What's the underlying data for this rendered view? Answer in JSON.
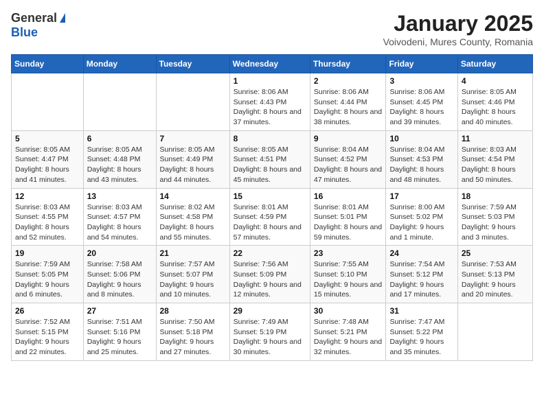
{
  "header": {
    "logo_general": "General",
    "logo_blue": "Blue",
    "month": "January 2025",
    "location": "Voivodeni, Mures County, Romania"
  },
  "weekdays": [
    "Sunday",
    "Monday",
    "Tuesday",
    "Wednesday",
    "Thursday",
    "Friday",
    "Saturday"
  ],
  "weeks": [
    [
      {
        "day": "",
        "info": ""
      },
      {
        "day": "",
        "info": ""
      },
      {
        "day": "",
        "info": ""
      },
      {
        "day": "1",
        "info": "Sunrise: 8:06 AM\nSunset: 4:43 PM\nDaylight: 8 hours and 37 minutes."
      },
      {
        "day": "2",
        "info": "Sunrise: 8:06 AM\nSunset: 4:44 PM\nDaylight: 8 hours and 38 minutes."
      },
      {
        "day": "3",
        "info": "Sunrise: 8:06 AM\nSunset: 4:45 PM\nDaylight: 8 hours and 39 minutes."
      },
      {
        "day": "4",
        "info": "Sunrise: 8:05 AM\nSunset: 4:46 PM\nDaylight: 8 hours and 40 minutes."
      }
    ],
    [
      {
        "day": "5",
        "info": "Sunrise: 8:05 AM\nSunset: 4:47 PM\nDaylight: 8 hours and 41 minutes."
      },
      {
        "day": "6",
        "info": "Sunrise: 8:05 AM\nSunset: 4:48 PM\nDaylight: 8 hours and 43 minutes."
      },
      {
        "day": "7",
        "info": "Sunrise: 8:05 AM\nSunset: 4:49 PM\nDaylight: 8 hours and 44 minutes."
      },
      {
        "day": "8",
        "info": "Sunrise: 8:05 AM\nSunset: 4:51 PM\nDaylight: 8 hours and 45 minutes."
      },
      {
        "day": "9",
        "info": "Sunrise: 8:04 AM\nSunset: 4:52 PM\nDaylight: 8 hours and 47 minutes."
      },
      {
        "day": "10",
        "info": "Sunrise: 8:04 AM\nSunset: 4:53 PM\nDaylight: 8 hours and 48 minutes."
      },
      {
        "day": "11",
        "info": "Sunrise: 8:03 AM\nSunset: 4:54 PM\nDaylight: 8 hours and 50 minutes."
      }
    ],
    [
      {
        "day": "12",
        "info": "Sunrise: 8:03 AM\nSunset: 4:55 PM\nDaylight: 8 hours and 52 minutes."
      },
      {
        "day": "13",
        "info": "Sunrise: 8:03 AM\nSunset: 4:57 PM\nDaylight: 8 hours and 54 minutes."
      },
      {
        "day": "14",
        "info": "Sunrise: 8:02 AM\nSunset: 4:58 PM\nDaylight: 8 hours and 55 minutes."
      },
      {
        "day": "15",
        "info": "Sunrise: 8:01 AM\nSunset: 4:59 PM\nDaylight: 8 hours and 57 minutes."
      },
      {
        "day": "16",
        "info": "Sunrise: 8:01 AM\nSunset: 5:01 PM\nDaylight: 8 hours and 59 minutes."
      },
      {
        "day": "17",
        "info": "Sunrise: 8:00 AM\nSunset: 5:02 PM\nDaylight: 9 hours and 1 minute."
      },
      {
        "day": "18",
        "info": "Sunrise: 7:59 AM\nSunset: 5:03 PM\nDaylight: 9 hours and 3 minutes."
      }
    ],
    [
      {
        "day": "19",
        "info": "Sunrise: 7:59 AM\nSunset: 5:05 PM\nDaylight: 9 hours and 6 minutes."
      },
      {
        "day": "20",
        "info": "Sunrise: 7:58 AM\nSunset: 5:06 PM\nDaylight: 9 hours and 8 minutes."
      },
      {
        "day": "21",
        "info": "Sunrise: 7:57 AM\nSunset: 5:07 PM\nDaylight: 9 hours and 10 minutes."
      },
      {
        "day": "22",
        "info": "Sunrise: 7:56 AM\nSunset: 5:09 PM\nDaylight: 9 hours and 12 minutes."
      },
      {
        "day": "23",
        "info": "Sunrise: 7:55 AM\nSunset: 5:10 PM\nDaylight: 9 hours and 15 minutes."
      },
      {
        "day": "24",
        "info": "Sunrise: 7:54 AM\nSunset: 5:12 PM\nDaylight: 9 hours and 17 minutes."
      },
      {
        "day": "25",
        "info": "Sunrise: 7:53 AM\nSunset: 5:13 PM\nDaylight: 9 hours and 20 minutes."
      }
    ],
    [
      {
        "day": "26",
        "info": "Sunrise: 7:52 AM\nSunset: 5:15 PM\nDaylight: 9 hours and 22 minutes."
      },
      {
        "day": "27",
        "info": "Sunrise: 7:51 AM\nSunset: 5:16 PM\nDaylight: 9 hours and 25 minutes."
      },
      {
        "day": "28",
        "info": "Sunrise: 7:50 AM\nSunset: 5:18 PM\nDaylight: 9 hours and 27 minutes."
      },
      {
        "day": "29",
        "info": "Sunrise: 7:49 AM\nSunset: 5:19 PM\nDaylight: 9 hours and 30 minutes."
      },
      {
        "day": "30",
        "info": "Sunrise: 7:48 AM\nSunset: 5:21 PM\nDaylight: 9 hours and 32 minutes."
      },
      {
        "day": "31",
        "info": "Sunrise: 7:47 AM\nSunset: 5:22 PM\nDaylight: 9 hours and 35 minutes."
      },
      {
        "day": "",
        "info": ""
      }
    ]
  ]
}
